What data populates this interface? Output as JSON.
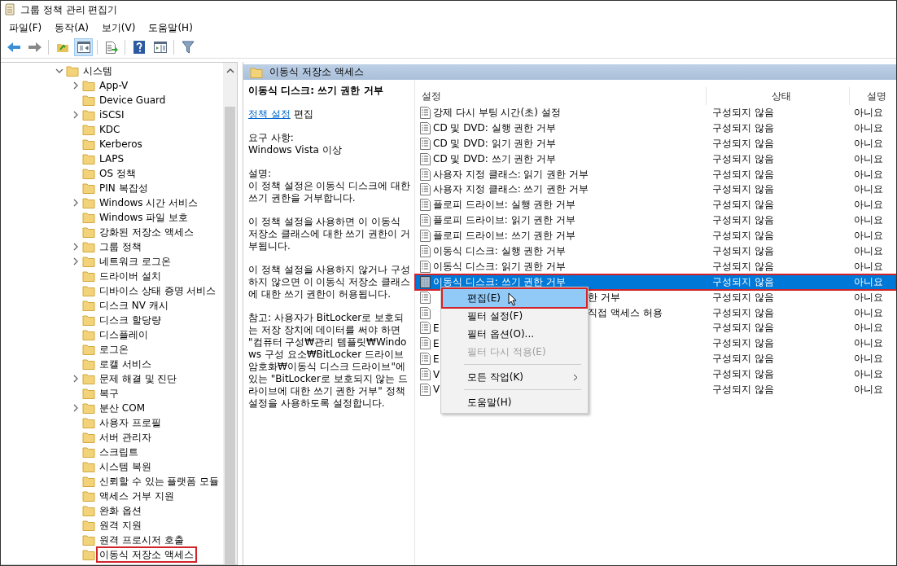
{
  "window": {
    "title": "그룹 정책 관리 편집기"
  },
  "menu": [
    "파일(F)",
    "동작(A)",
    "보기(V)",
    "도움말(H)"
  ],
  "toolbar": [
    {
      "kind": "back",
      "pressed": false
    },
    {
      "kind": "forward",
      "pressed": false
    },
    {
      "kind": "sep"
    },
    {
      "kind": "up",
      "pressed": false
    },
    {
      "kind": "tree",
      "pressed": true
    },
    {
      "kind": "sep"
    },
    {
      "kind": "export",
      "pressed": false
    },
    {
      "kind": "sep"
    },
    {
      "kind": "help",
      "pressed": false
    },
    {
      "kind": "pane",
      "pressed": false
    },
    {
      "kind": "sep"
    },
    {
      "kind": "filter",
      "pressed": false
    }
  ],
  "tree": [
    {
      "label": "시스템",
      "expanded": true,
      "children": [
        {
          "label": "App-V",
          "expandable": true,
          "annotated": false
        },
        {
          "label": "Device Guard",
          "expandable": false,
          "annotated": false
        },
        {
          "label": "iSCSI",
          "expandable": true,
          "annotated": false
        },
        {
          "label": "KDC",
          "expandable": false,
          "annotated": false
        },
        {
          "label": "Kerberos",
          "expandable": false,
          "annotated": false
        },
        {
          "label": "LAPS",
          "expandable": false,
          "annotated": false
        },
        {
          "label": "OS 정책",
          "expandable": false,
          "annotated": false
        },
        {
          "label": "PIN 복잡성",
          "expandable": false,
          "annotated": false
        },
        {
          "label": "Windows 시간 서비스",
          "expandable": true,
          "annotated": false
        },
        {
          "label": "Windows 파일 보호",
          "expandable": false,
          "annotated": false
        },
        {
          "label": "강화된 저장소 액세스",
          "expandable": false,
          "annotated": false
        },
        {
          "label": "그룹 정책",
          "expandable": true,
          "annotated": false
        },
        {
          "label": "네트워크 로그온",
          "expandable": true,
          "annotated": false
        },
        {
          "label": "드라이버 설치",
          "expandable": false,
          "annotated": false
        },
        {
          "label": "디바이스 상태 증명 서비스",
          "expandable": false,
          "annotated": false
        },
        {
          "label": "디스크 NV 캐시",
          "expandable": false,
          "annotated": false
        },
        {
          "label": "디스크 할당량",
          "expandable": false,
          "annotated": false
        },
        {
          "label": "디스플레이",
          "expandable": false,
          "annotated": false
        },
        {
          "label": "로그온",
          "expandable": false,
          "annotated": false
        },
        {
          "label": "로캘 서비스",
          "expandable": false,
          "annotated": false
        },
        {
          "label": "문제 해결 및 진단",
          "expandable": true,
          "annotated": false
        },
        {
          "label": "복구",
          "expandable": false,
          "annotated": false
        },
        {
          "label": "분산 COM",
          "expandable": true,
          "annotated": false
        },
        {
          "label": "사용자 프로필",
          "expandable": false,
          "annotated": false
        },
        {
          "label": "서버 관리자",
          "expandable": false,
          "annotated": false
        },
        {
          "label": "스크립트",
          "expandable": false,
          "annotated": false
        },
        {
          "label": "시스템 복원",
          "expandable": false,
          "annotated": false
        },
        {
          "label": "신뢰할 수 있는 플랫폼 모듈",
          "expandable": false,
          "annotated": false
        },
        {
          "label": "액세스 거부 지원",
          "expandable": false,
          "annotated": false
        },
        {
          "label": "완화 옵션",
          "expandable": false,
          "annotated": false
        },
        {
          "label": "원격 지원",
          "expandable": false,
          "annotated": false
        },
        {
          "label": "원격 프로시저 호출",
          "expandable": false,
          "annotated": false
        },
        {
          "label": "이동식 저장소 액세스",
          "expandable": false,
          "annotated": true
        }
      ]
    }
  ],
  "pane_header": "이동식 저장소 액세스",
  "description": {
    "title": "이동식 디스크: 쓰기 권한 거부",
    "link": "정책 설정",
    "link_suffix": "편집",
    "requirements_label": "요구 사항:",
    "requirements": "Windows Vista 이상",
    "description_label": "설명:",
    "paragraphs": [
      "이 정책 설정은 이동식 디스크에 대한 쓰기 권한을 거부합니다.",
      "이 정책 설정을 사용하면 이 이동식 저장소 클래스에 대한 쓰기 권한이 거부됩니다.",
      "이 정책 설정을 사용하지 않거나 구성하지 않으면 이 이동식 저장소 클래스에 대한 쓰기 권한이 허용됩니다.",
      "참고: 사용자가 BitLocker로 보호되는 저장 장치에 데이터를 써야 하면 \"컴퓨터 구성₩관리 템플릿₩Windows 구성 요소₩BitLocker 드라이브 암호화₩이동식 디스크 드라이브\"에 있는 \"BitLocker로 보호되지 않는 드라이브에 대한 쓰기 권한 거부\" 정책 설정을 사용하도록 설정합니다."
    ]
  },
  "table": {
    "columns": [
      "설정",
      "상태",
      "설명"
    ],
    "rows": [
      {
        "kind": "full",
        "name": "강제 다시 부팅 시간(초) 설정",
        "state": "구성되지 않음",
        "comment": "아니요",
        "selected": false
      },
      {
        "kind": "full",
        "name": "CD 및 DVD: 실행 권한 거부",
        "state": "구성되지 않음",
        "comment": "아니요",
        "selected": false
      },
      {
        "kind": "full",
        "name": "CD 및 DVD: 읽기 권한 거부",
        "state": "구성되지 않음",
        "comment": "아니요",
        "selected": false
      },
      {
        "kind": "full",
        "name": "CD 및 DVD: 쓰기 권한 거부",
        "state": "구성되지 않음",
        "comment": "아니요",
        "selected": false
      },
      {
        "kind": "full",
        "name": "사용자 지정 클래스: 읽기 권한 거부",
        "state": "구성되지 않음",
        "comment": "아니요",
        "selected": false
      },
      {
        "kind": "full",
        "name": "사용자 지정 클래스: 쓰기 권한 거부",
        "state": "구성되지 않음",
        "comment": "아니요",
        "selected": false
      },
      {
        "kind": "full",
        "name": "플로피 드라이브: 실행 권한 거부",
        "state": "구성되지 않음",
        "comment": "아니요",
        "selected": false
      },
      {
        "kind": "full",
        "name": "플로피 드라이브: 읽기 권한 거부",
        "state": "구성되지 않음",
        "comment": "아니요",
        "selected": false
      },
      {
        "kind": "full",
        "name": "플로피 드라이브: 쓰기 권한 거부",
        "state": "구성되지 않음",
        "comment": "아니요",
        "selected": false
      },
      {
        "kind": "full",
        "name": "이동식 디스크: 실행 권한 거부",
        "state": "구성되지 않음",
        "comment": "아니요",
        "selected": false
      },
      {
        "kind": "full",
        "name": "이동식 디스크: 읽기 권한 거부",
        "state": "구성되지 않음",
        "comment": "아니요",
        "selected": false
      },
      {
        "kind": "full",
        "name": "이동식 디스크: 쓰기 권한 거부",
        "state": "구성되지 않음",
        "comment": "아니요",
        "selected": true,
        "annotated": true
      },
      {
        "kind": "after_menu",
        "name": "한 거부",
        "state": "구성되지 않음",
        "comment": "아니요",
        "selected": false
      },
      {
        "kind": "after_menu",
        "name": "직접 액세스 허용",
        "state": "구성되지 않음",
        "comment": "아니요",
        "selected": false
      },
      {
        "kind": "full",
        "name": "E",
        "state": "구성되지 않음",
        "comment": "아니요",
        "selected": false
      },
      {
        "kind": "full",
        "name": "E",
        "state": "구성되지 않음",
        "comment": "아니요",
        "selected": false
      },
      {
        "kind": "full",
        "name": "E",
        "state": "구성되지 않음",
        "comment": "아니요",
        "selected": false
      },
      {
        "kind": "full",
        "name": "V",
        "state": "구성되지 않음",
        "comment": "아니요",
        "selected": false
      },
      {
        "kind": "full",
        "name": "V",
        "state": "구성되지 않음",
        "comment": "아니요",
        "selected": false
      }
    ]
  },
  "context_menu": [
    {
      "kind": "item",
      "label": "편집(E)",
      "highlighted": true,
      "disabled": false,
      "annotated": true
    },
    {
      "kind": "item",
      "label": "필터 설정(F)",
      "highlighted": false,
      "disabled": false,
      "annotated": false
    },
    {
      "kind": "item",
      "label": "필터 옵션(O)...",
      "highlighted": false,
      "disabled": false,
      "annotated": false
    },
    {
      "kind": "item",
      "label": "필터 다시 적용(E)",
      "highlighted": false,
      "disabled": true,
      "annotated": false
    },
    {
      "kind": "separator"
    },
    {
      "kind": "submenu",
      "label": "모든 작업(K)",
      "highlighted": false,
      "disabled": false,
      "annotated": false
    },
    {
      "kind": "separator"
    },
    {
      "kind": "item",
      "label": "도움말(H)",
      "highlighted": false,
      "disabled": false,
      "annotated": false
    }
  ]
}
